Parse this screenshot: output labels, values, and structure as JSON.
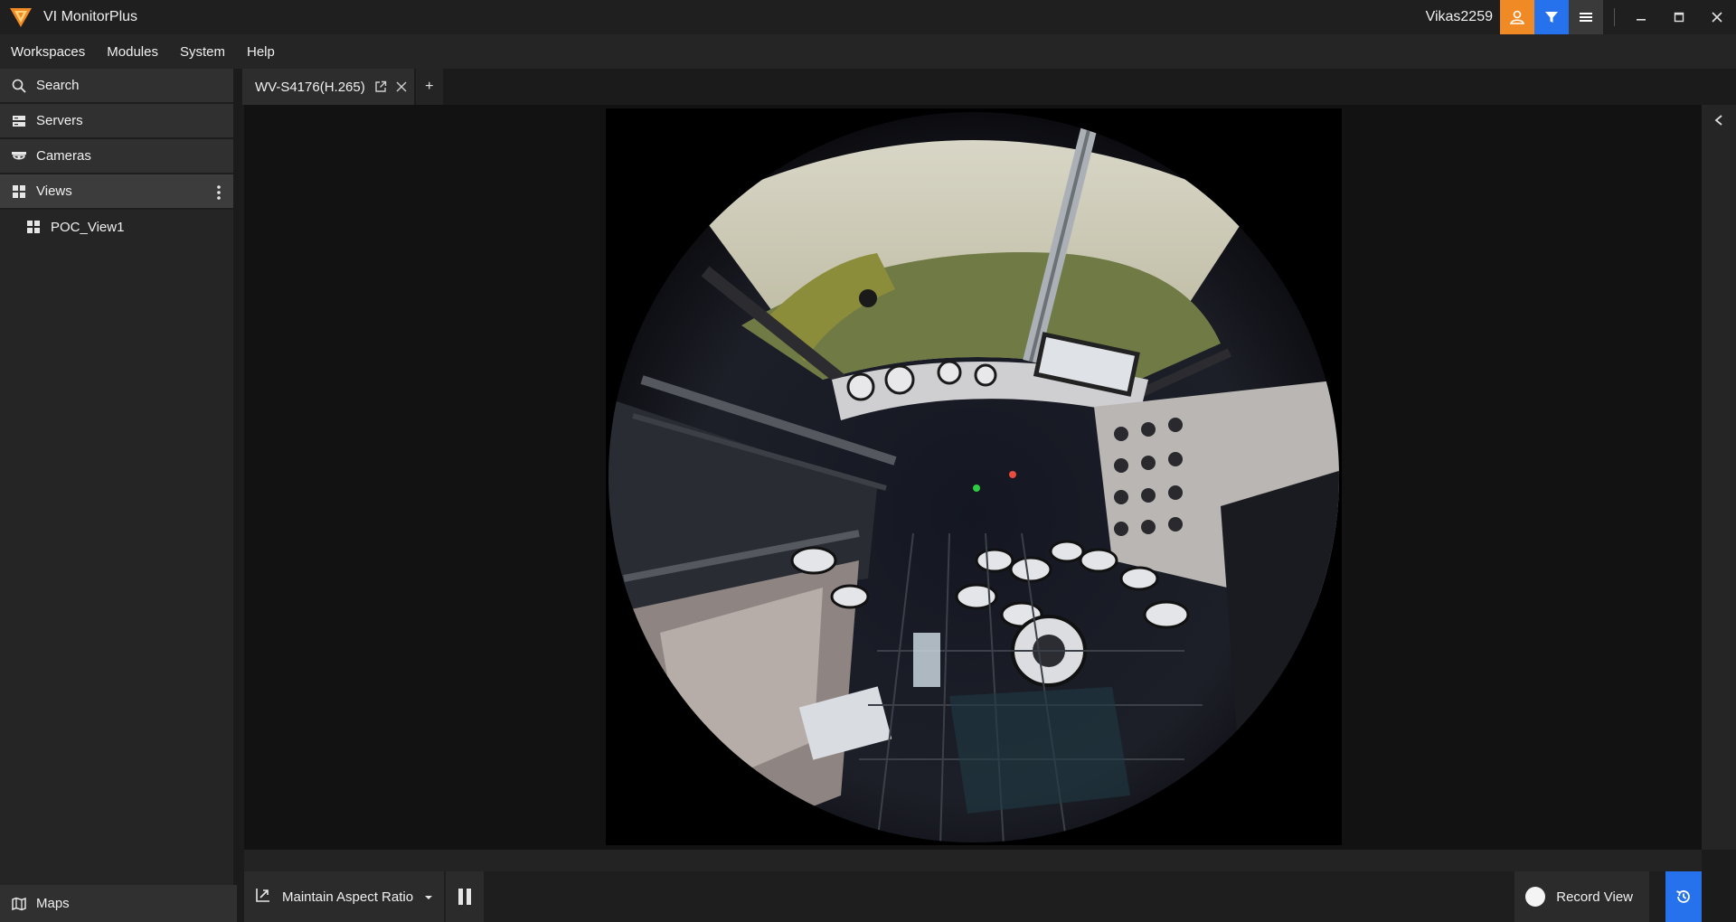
{
  "app": {
    "title": "VI MonitorPlus",
    "username": "Vikas2259"
  },
  "colors": {
    "accent_orange": "#f08a24",
    "accent_blue": "#2672ec",
    "background": "#1b1b1b"
  },
  "icons": {
    "logo": "triangle-logo-icon",
    "user": "user-icon",
    "filter": "filter-icon",
    "menu": "hamburger-icon",
    "minimize": "minimize-icon",
    "maximize": "maximize-icon",
    "close": "close-icon"
  },
  "menubar": {
    "items": [
      "Workspaces",
      "Modules",
      "System",
      "Help"
    ]
  },
  "sidebar": {
    "items": [
      {
        "label": "Search",
        "icon": "search-icon"
      },
      {
        "label": "Servers",
        "icon": "server-icon"
      },
      {
        "label": "Cameras",
        "icon": "camera-icon"
      },
      {
        "label": "Views",
        "icon": "grid-icon"
      }
    ],
    "views": [
      {
        "label": "POC_View1",
        "icon": "grid-icon"
      }
    ],
    "bottom": {
      "label": "Maps",
      "icon": "map-icon"
    }
  },
  "tabs": [
    {
      "label": "WV-S4176(H.265)"
    }
  ],
  "tab_add": "+",
  "toolbar": {
    "aspect_label": "Maintain Aspect Ratio",
    "record_label": "Record View"
  }
}
